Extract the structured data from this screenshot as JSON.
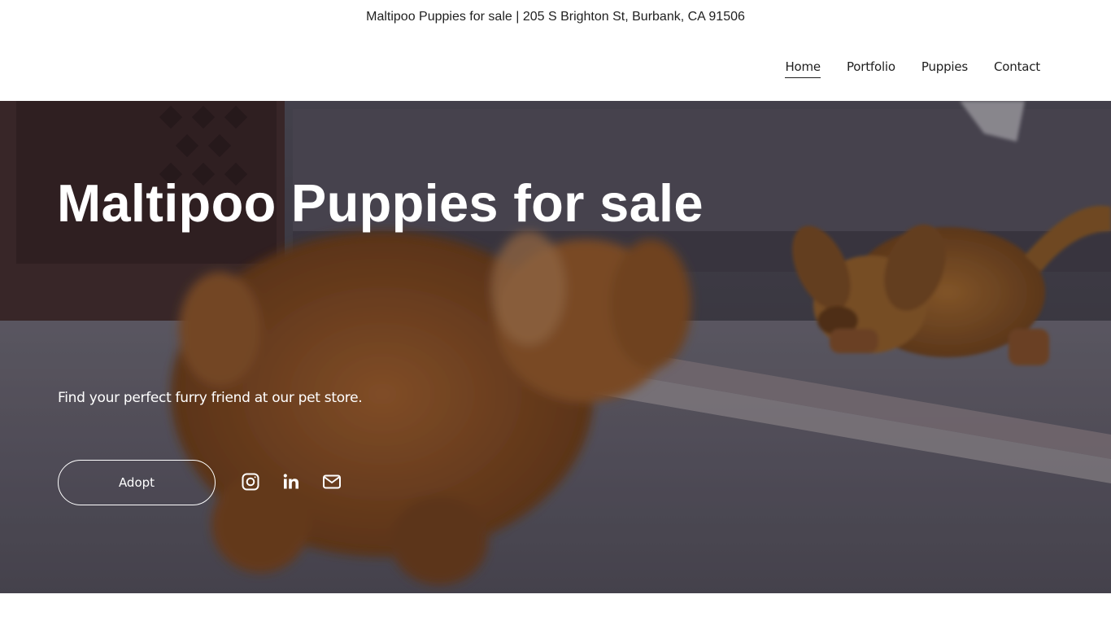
{
  "topbar": {
    "text": "Maltipoo Puppies for sale | 205 S Brighton St, Burbank, CA 91506"
  },
  "nav": {
    "items": [
      {
        "label": "Home",
        "active": true
      },
      {
        "label": "Portfolio",
        "active": false
      },
      {
        "label": "Puppies",
        "active": false
      },
      {
        "label": "Contact",
        "active": false
      }
    ]
  },
  "hero": {
    "title": "Maltipoo Puppies for sale",
    "subtitle": "Find your perfect furry friend at our pet store.",
    "button_label": "Adopt",
    "social_icons": [
      "instagram-icon",
      "linkedin-icon",
      "email-icon"
    ]
  },
  "colors": {
    "text_dark": "#1f1f1f",
    "hero_text": "#ffffff",
    "page_bg": "#ffffff"
  }
}
